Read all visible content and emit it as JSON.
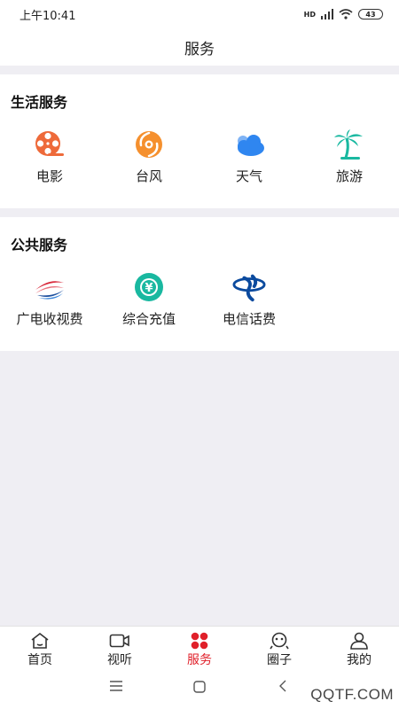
{
  "status_bar": {
    "time": "上午10:41",
    "network": "HD",
    "battery": "43"
  },
  "header": {
    "title": "服务"
  },
  "life_services": {
    "title": "生活服务",
    "items": [
      {
        "label": "电影",
        "icon": "film-reel-icon"
      },
      {
        "label": "台风",
        "icon": "typhoon-icon"
      },
      {
        "label": "天气",
        "icon": "cloud-icon"
      },
      {
        "label": "旅游",
        "icon": "palm-tree-icon"
      }
    ]
  },
  "public_services": {
    "title": "公共服务",
    "items": [
      {
        "label": "广电收视费",
        "icon": "broadcast-logo-icon"
      },
      {
        "label": "综合充值",
        "icon": "yuan-coin-icon"
      },
      {
        "label": "电信话费",
        "icon": "china-telecom-icon"
      }
    ]
  },
  "tab_bar": {
    "tabs": [
      {
        "label": "首页",
        "icon": "home-icon",
        "active": false
      },
      {
        "label": "视听",
        "icon": "video-camera-icon",
        "active": false
      },
      {
        "label": "服务",
        "icon": "grid-dots-icon",
        "active": true
      },
      {
        "label": "圈子",
        "icon": "community-icon",
        "active": false
      },
      {
        "label": "我的",
        "icon": "user-icon",
        "active": false
      }
    ]
  },
  "watermark": "QQTF.COM",
  "colors": {
    "accent_red": "#e0202a",
    "film_orange": "#ee6a3a",
    "typhoon_orange": "#f5902e",
    "weather_blue": "#2f86f0",
    "travel_teal": "#19b8a0",
    "page_bg": "#efeef3"
  }
}
